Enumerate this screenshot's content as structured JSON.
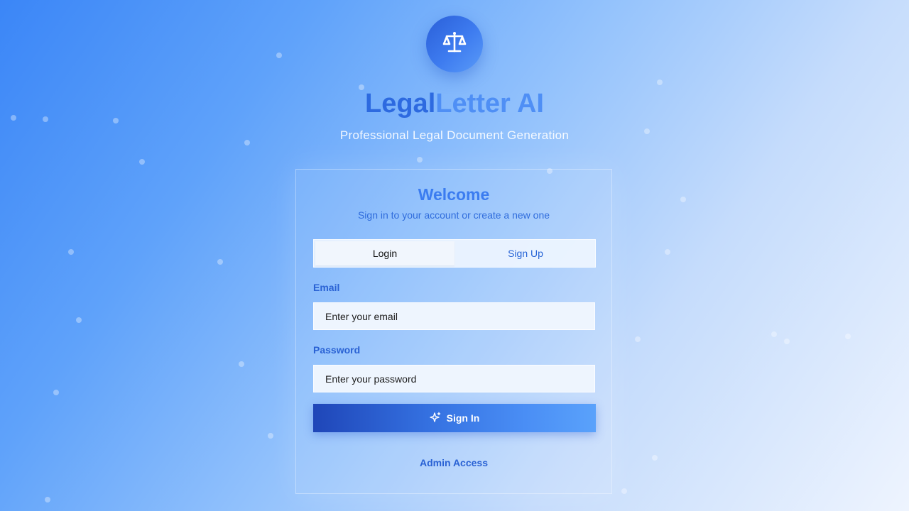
{
  "app": {
    "title_part1": "Legal",
    "title_part2": "Letter AI",
    "subtitle": "Professional Legal Document Generation",
    "logo_icon": "scale-icon"
  },
  "card": {
    "title": "Welcome",
    "subtitle": "Sign in to your account or create a new one"
  },
  "tabs": [
    {
      "label": "Login",
      "active": true
    },
    {
      "label": "Sign Up",
      "active": false
    }
  ],
  "form": {
    "email_label": "Email",
    "email_placeholder": "Enter your email",
    "email_value": "",
    "password_label": "Password",
    "password_placeholder": "Enter your password",
    "password_value": "",
    "submit_label": "Sign In",
    "submit_icon": "sparkles-icon"
  },
  "footer": {
    "admin_link": "Admin Access"
  },
  "colors": {
    "accent": "#3b7cf0",
    "accent_dark": "#1f46b8",
    "link": "#2a62d4"
  }
}
